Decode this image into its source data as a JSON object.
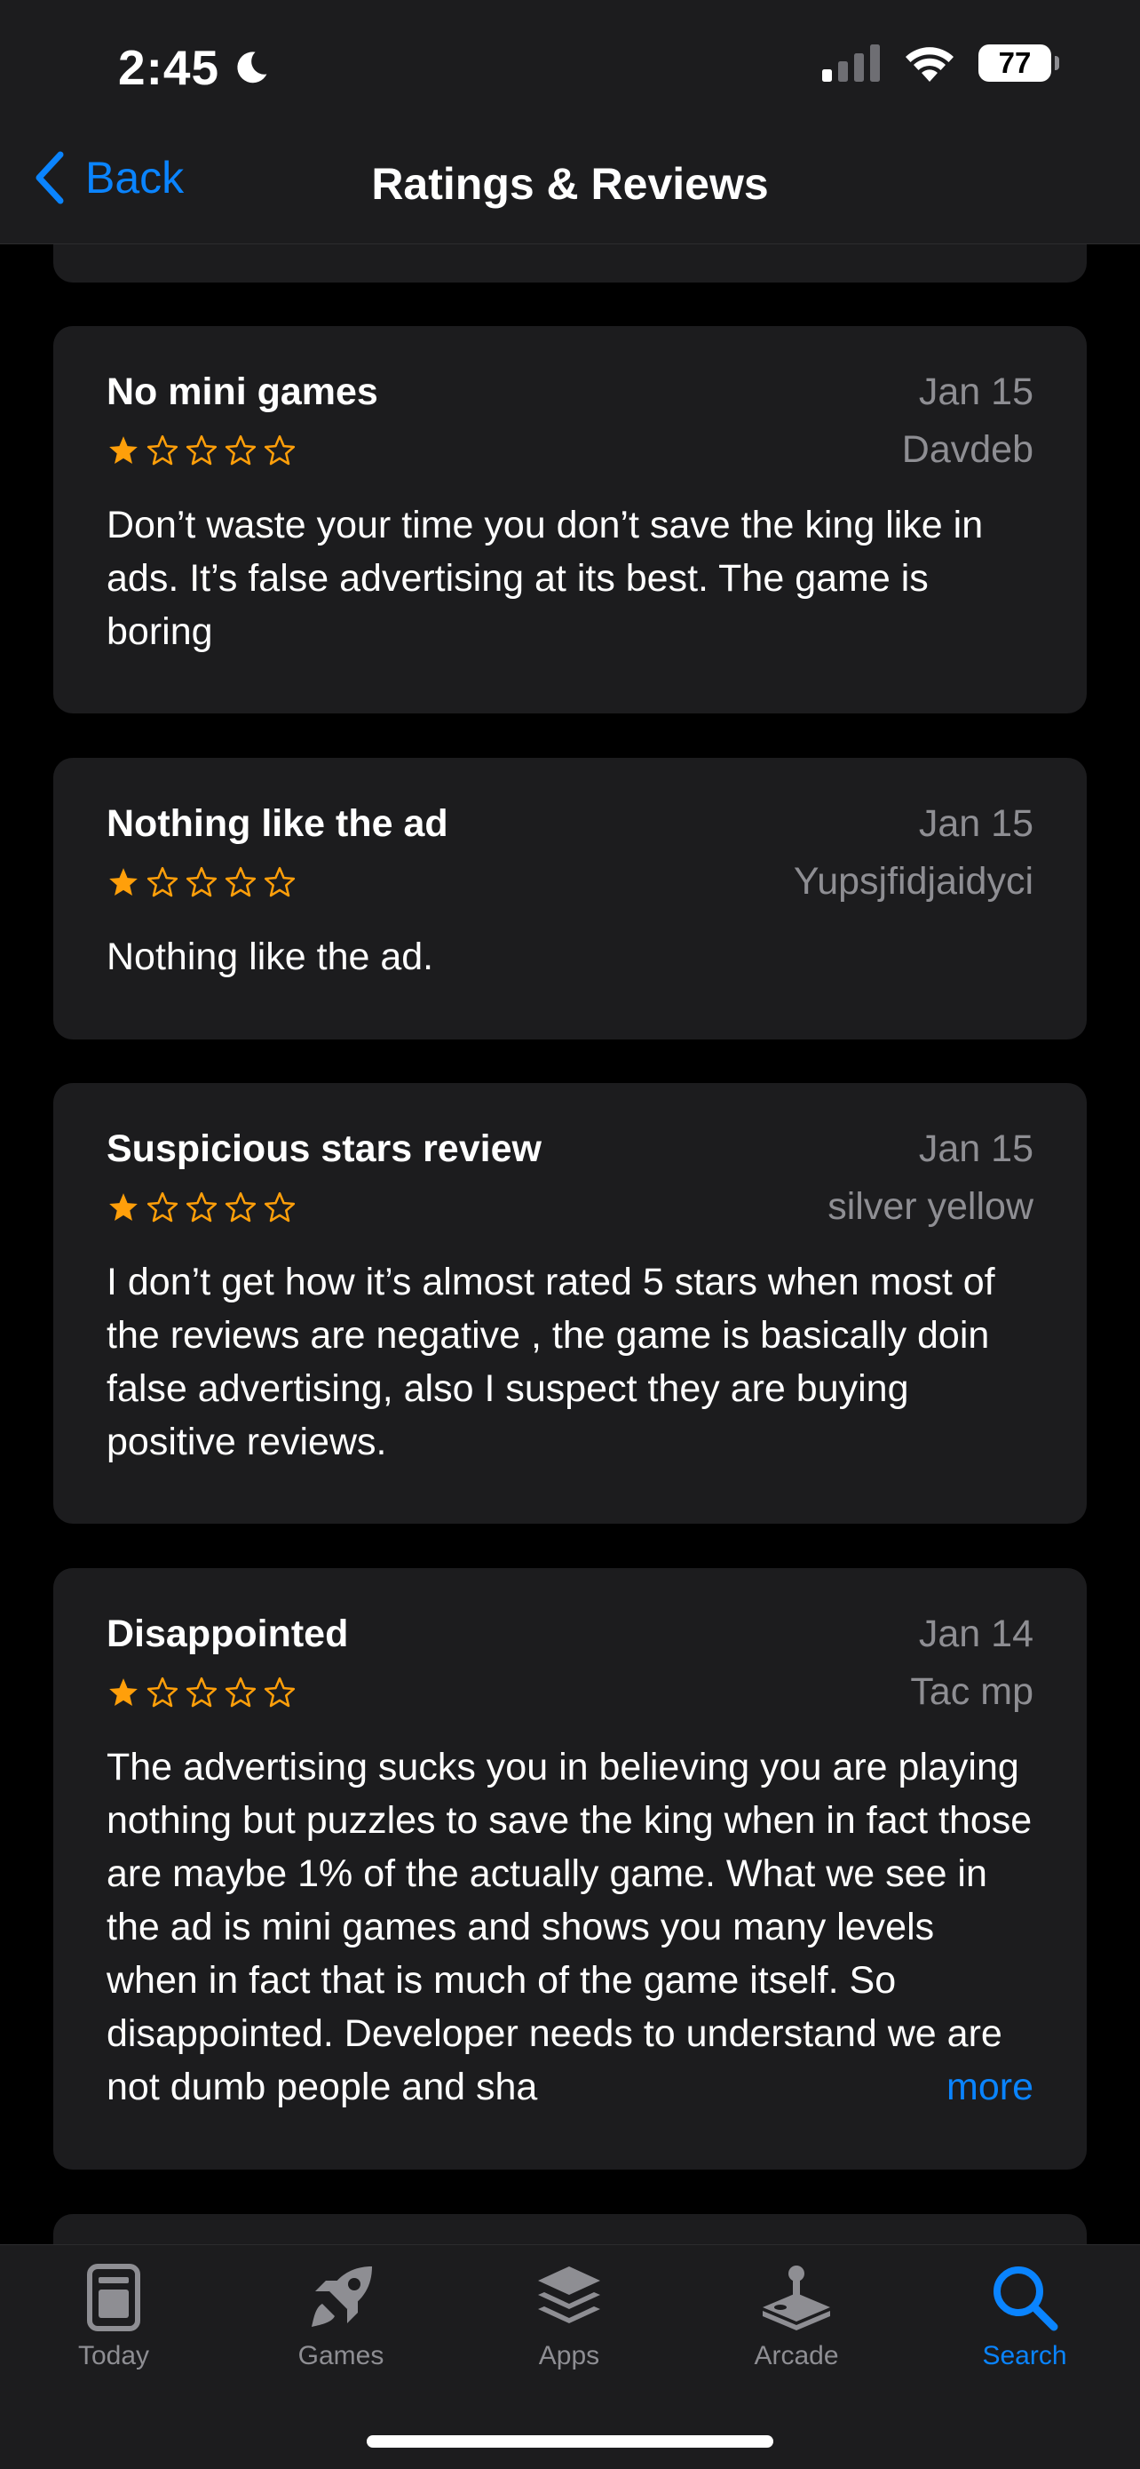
{
  "status_bar": {
    "time": "2:45",
    "battery": "77",
    "moon_icon": "moon-icon",
    "signal_icon": "cellular-signal-icon",
    "wifi_icon": "wifi-icon"
  },
  "nav": {
    "back_label": "Back",
    "title": "Ratings & Reviews",
    "back_icon": "chevron-left-icon"
  },
  "colors": {
    "accent": "#0a84ff",
    "star": "#ff9f0a",
    "card_bg": "#1c1c1e",
    "secondary_text": "#8e8e93",
    "background": "#000000"
  },
  "reviews": [
    {
      "title": "No mini games",
      "date": "Jan 15",
      "author": "Davdeb",
      "rating": 1,
      "body": "Don’t waste your time you don’t save the king like in ads. It’s false advertising at its best. The game is boring"
    },
    {
      "title": "Nothing like the ad",
      "date": "Jan 15",
      "author": "Yupsjfidjaidyci",
      "rating": 1,
      "body": "Nothing like the ad."
    },
    {
      "title": "Suspicious stars review",
      "date": "Jan 15",
      "author": "silver yellow",
      "rating": 1,
      "body": "I don’t get how it’s almost rated 5 stars when most of the reviews are negative , the game is basically doin false advertising, also I suspect they are buying positive reviews."
    },
    {
      "title": "Disappointed",
      "date": "Jan 14",
      "author": "Tac mp",
      "rating": 1,
      "body": "The advertising sucks you in believing you are playing nothing but puzzles to save the king when in fact those are maybe 1% of the actually game. What we see in the ad is mini games and shows you many levels when in fact that is much of the game itself. So disappointed. Developer needs to understand we are not dumb people and sha",
      "more_label": "more"
    }
  ],
  "tabbar": {
    "tabs": [
      {
        "label": "Today",
        "icon": "today-icon",
        "active": false
      },
      {
        "label": "Games",
        "icon": "rocket-icon",
        "active": false
      },
      {
        "label": "Apps",
        "icon": "apps-stack-icon",
        "active": false
      },
      {
        "label": "Arcade",
        "icon": "joystick-icon",
        "active": false
      },
      {
        "label": "Search",
        "icon": "search-icon",
        "active": true
      }
    ]
  }
}
